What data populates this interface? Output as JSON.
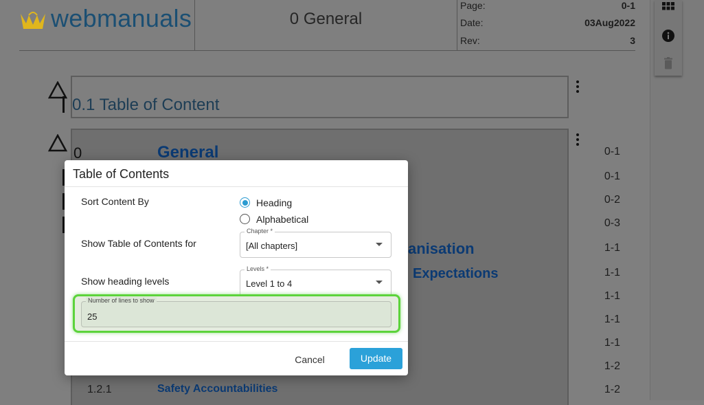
{
  "header": {
    "logo_text": "webmanuals",
    "title": "0 General",
    "meta": [
      {
        "label": "Page:",
        "value": "0-1"
      },
      {
        "label": "Date:",
        "value": "03Aug2022"
      },
      {
        "label": "Rev:",
        "value": "3"
      }
    ]
  },
  "sections": {
    "toc_heading": "0.1 Table of Content"
  },
  "toc": {
    "chapter_num": "0",
    "chapter_title": "General",
    "partial_1": "anisation",
    "partial_2": "Expectations",
    "row_1_2_1_num": "1.2.1",
    "row_1_2_1_title": "Safety Accountabilities",
    "pages": [
      "0-1",
      "0-1",
      "0-2",
      "0-3",
      "1-1",
      "1-1",
      "1-1",
      "1-1",
      "1-1",
      "1-2",
      "1-2"
    ]
  },
  "modal": {
    "title": "Table of Contents",
    "sort_label": "Sort Content By",
    "sort_options": [
      "Heading",
      "Alphabetical"
    ],
    "sort_selected": "Heading",
    "chapter_row_label": "Show Table of Contents for",
    "chapter_legend": "Chapter *",
    "chapter_value": "[All chapters]",
    "levels_row_label": "Show heading levels",
    "levels_legend": "Levels *",
    "levels_value": "Level 1 to 4",
    "lines_legend": "Number of lines to show",
    "lines_value": "25",
    "cancel_label": "Cancel",
    "update_label": "Update"
  },
  "colors": {
    "accent": "#2ba1d9",
    "highlight": "#5cd33b",
    "logo": "#1b4f73"
  },
  "icons": [
    "grid-icon",
    "info-icon",
    "trash-icon",
    "logo-crown-icon",
    "warning-triangle-icon",
    "more-vertical-icon"
  ]
}
